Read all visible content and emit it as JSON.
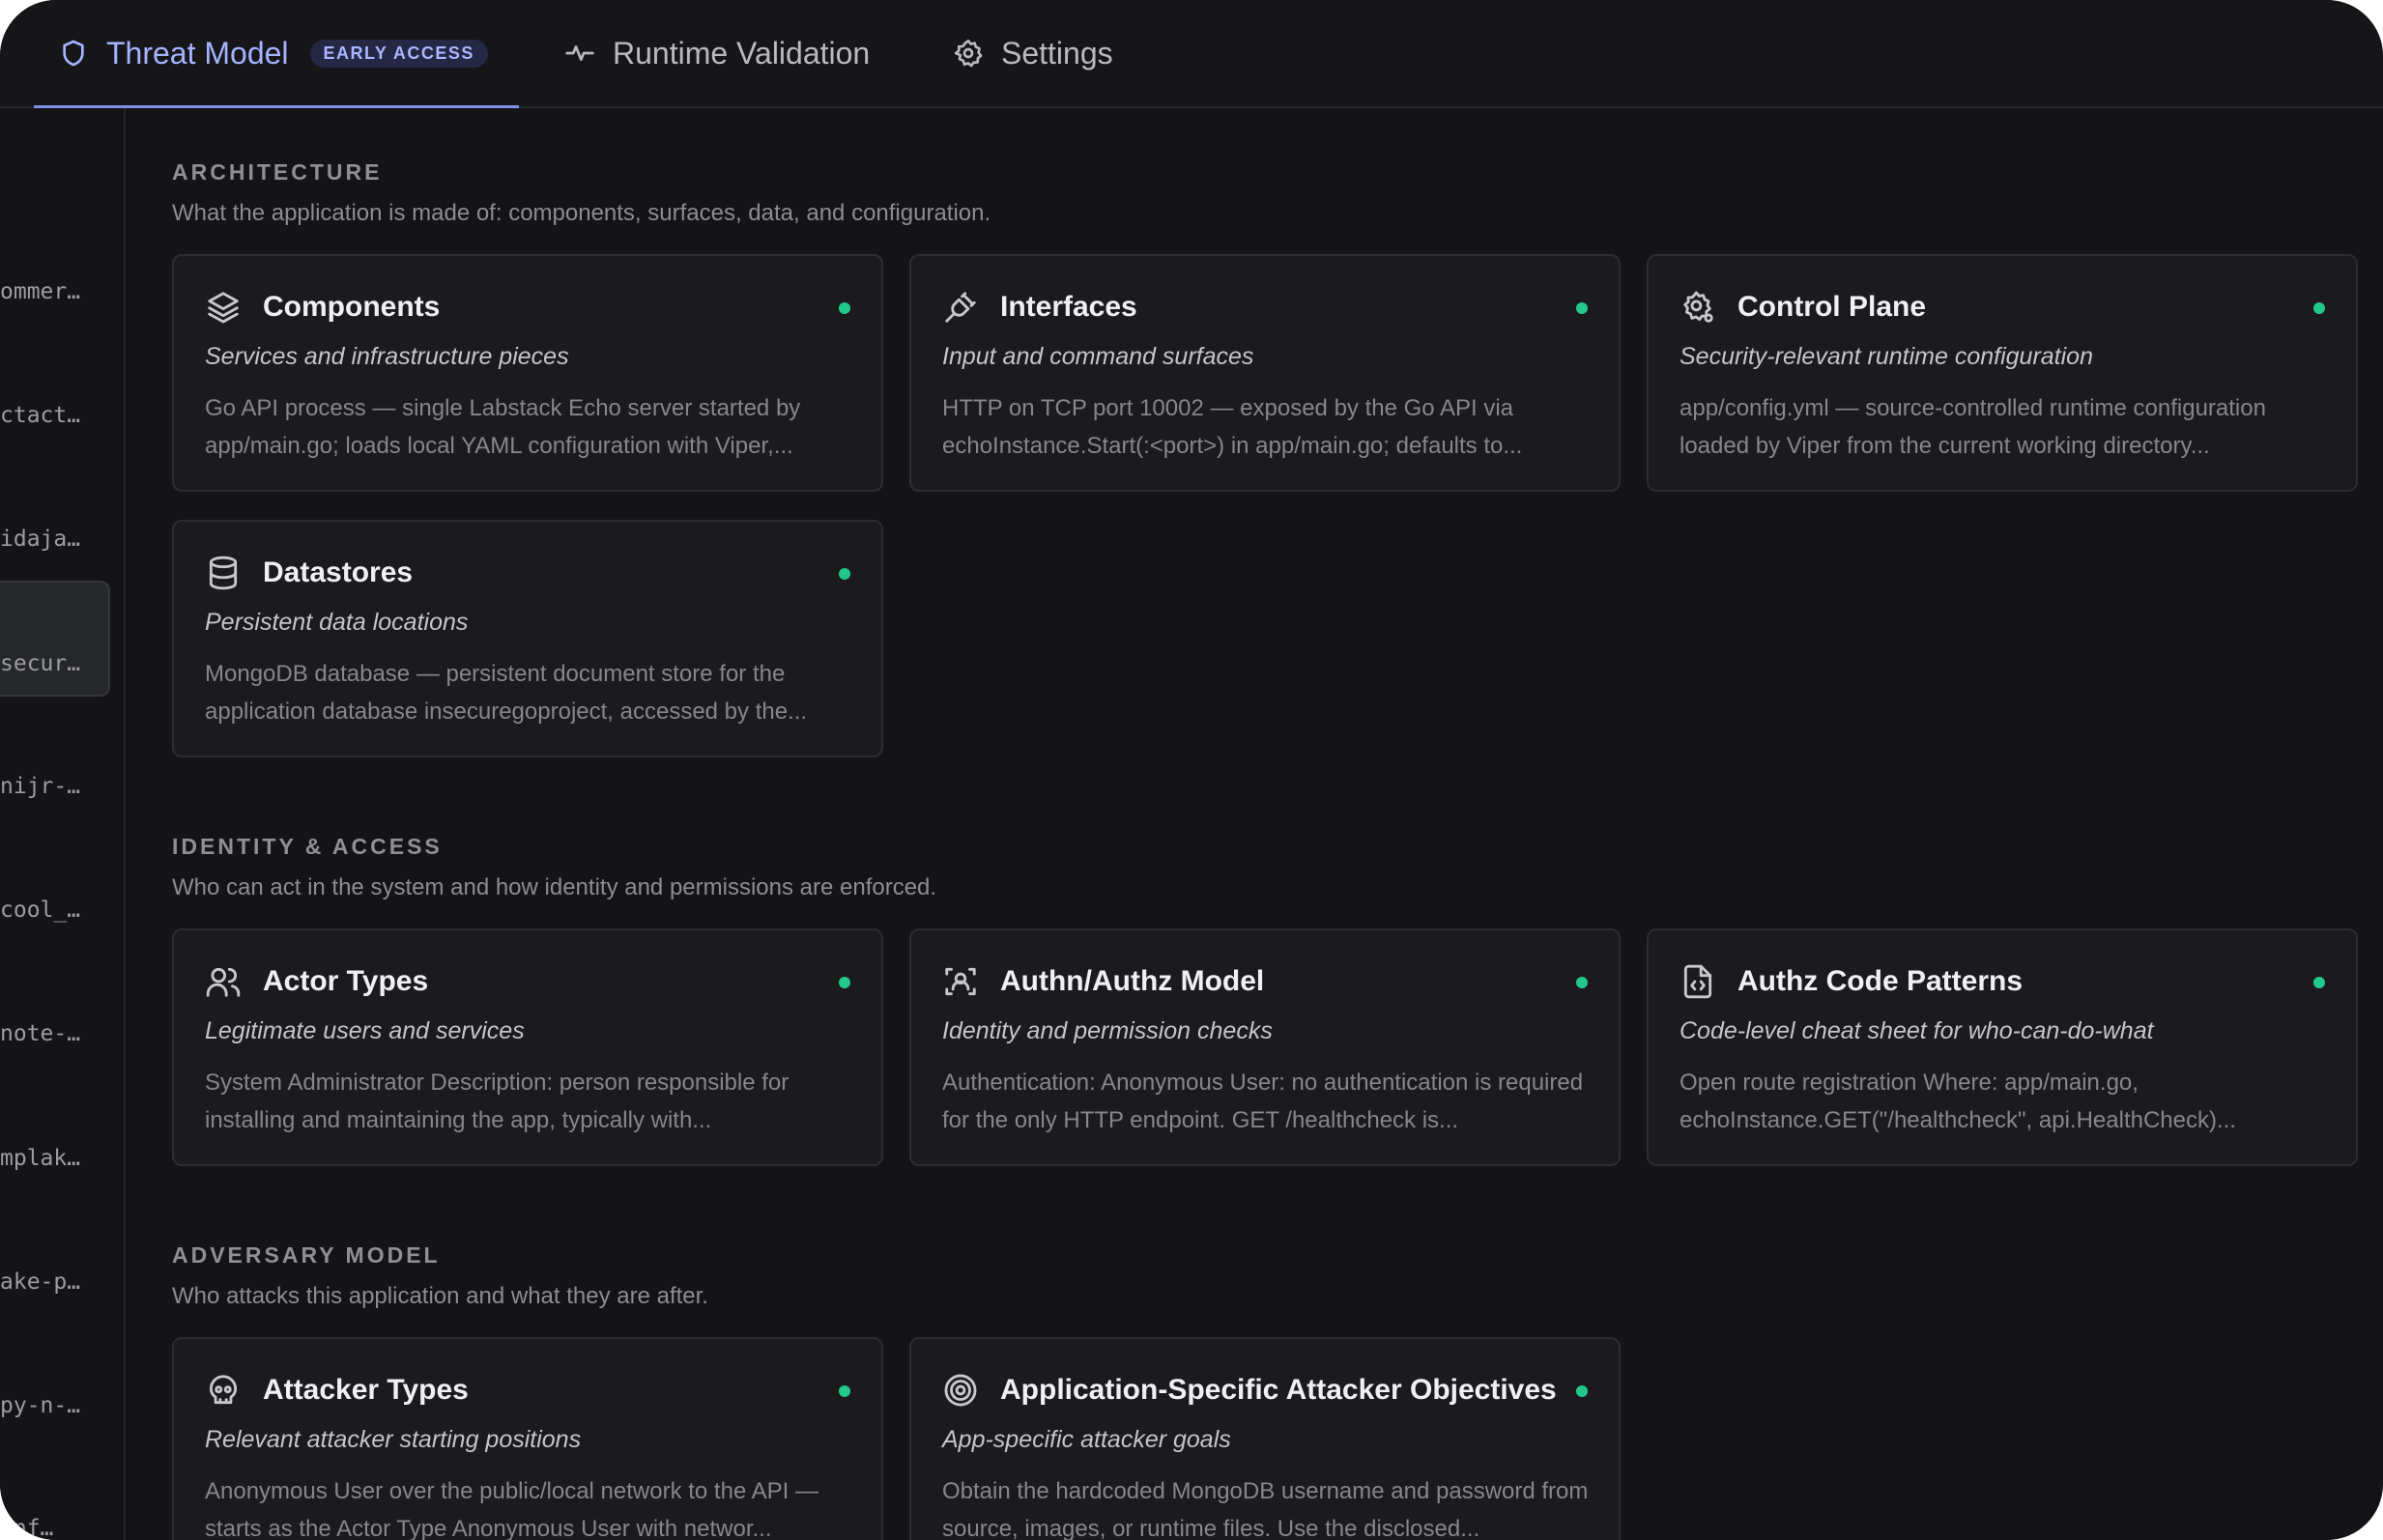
{
  "tabs": [
    {
      "label": "Threat Model",
      "badge": "EARLY ACCESS",
      "icon": "shield-icon",
      "active": true
    },
    {
      "label": "Runtime Validation",
      "icon": "activity-icon",
      "active": false
    },
    {
      "label": "Settings",
      "icon": "gear-icon",
      "active": false
    }
  ],
  "rail": {
    "items": [
      {
        "label": "ommer…"
      },
      {
        "label": "ctact…"
      },
      {
        "label": "idaja…"
      },
      {
        "label": "secur…",
        "selected": true
      },
      {
        "label": "nijr-…"
      },
      {
        "label": "cool_…"
      },
      {
        "label": "note-…"
      },
      {
        "label": "mplak…"
      },
      {
        "label": "ake-p…"
      },
      {
        "label": "py-n-…"
      },
      {
        "label": "onf…"
      }
    ]
  },
  "sections": [
    {
      "title": "ARCHITECTURE",
      "description": "What the application is made of: components, surfaces, data, and configuration.",
      "cards": [
        {
          "title": "Components",
          "subtitle": "Services and infrastructure pieces",
          "description": "Go API process — single Labstack Echo server started by app/main.go; loads local YAML configuration with Viper,...",
          "icon": "layers-icon",
          "status_color": "#22c98a"
        },
        {
          "title": "Interfaces",
          "subtitle": "Input and command surfaces",
          "description": "HTTP on TCP port 10002 — exposed by the Go API via echoInstance.Start(:<port>) in app/main.go; defaults to...",
          "icon": "plug-icon",
          "status_color": "#22c98a"
        },
        {
          "title": "Control Plane",
          "subtitle": "Security-relevant runtime configuration",
          "description": "app/config.yml — source-controlled runtime configuration loaded by Viper from the current working directory...",
          "icon": "settings-cog-icon",
          "status_color": "#22c98a"
        },
        {
          "title": "Datastores",
          "subtitle": "Persistent data locations",
          "description": "MongoDB database — persistent document store for the application database insecuregoproject, accessed by the...",
          "icon": "database-icon",
          "status_color": "#22c98a"
        }
      ]
    },
    {
      "title": "IDENTITY & ACCESS",
      "description": "Who can act in the system and how identity and permissions are enforced.",
      "cards": [
        {
          "title": "Actor Types",
          "subtitle": "Legitimate users and services",
          "description": "System Administrator Description: person responsible for installing and maintaining the app, typically with...",
          "icon": "users-icon",
          "status_color": "#22c98a"
        },
        {
          "title": "Authn/Authz Model",
          "subtitle": "Identity and permission checks",
          "description": "Authentication: Anonymous User: no authentication is required for the only HTTP endpoint. GET /healthcheck is...",
          "icon": "scan-user-icon",
          "status_color": "#22c98a"
        },
        {
          "title": "Authz Code Patterns",
          "subtitle": "Code-level cheat sheet for who-can-do-what",
          "description": "Open route registration Where: app/main.go, echoInstance.GET(\"/healthcheck\", api.HealthCheck)...",
          "icon": "file-code-icon",
          "status_color": "#22c98a"
        }
      ]
    },
    {
      "title": "ADVERSARY MODEL",
      "description": "Who attacks this application and what they are after.",
      "cards": [
        {
          "title": "Attacker Types",
          "subtitle": "Relevant attacker starting positions",
          "description": "Anonymous User over the public/local network to the API — starts as the Actor Type Anonymous User with networ...",
          "icon": "skull-icon",
          "status_color": "#22c98a"
        },
        {
          "title": "Application-Specific Attacker Objectives",
          "subtitle": "App-specific attacker goals",
          "description": "Obtain the hardcoded MongoDB username and password from source, images, or runtime files. Use the disclosed...",
          "icon": "target-icon",
          "status_color": "#22c98a"
        }
      ]
    }
  ]
}
